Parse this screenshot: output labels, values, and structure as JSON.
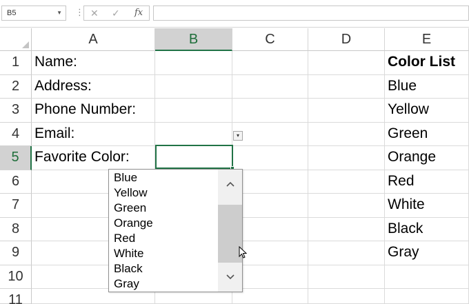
{
  "formula_bar": {
    "name_box": "B5",
    "cancel_symbol": "✕",
    "enter_symbol": "✓",
    "function_symbol": "fx",
    "formula_value": ""
  },
  "columns": [
    "A",
    "B",
    "C",
    "D",
    "E"
  ],
  "rows": [
    "1",
    "2",
    "3",
    "4",
    "5",
    "6",
    "7",
    "8",
    "9",
    "10",
    "11"
  ],
  "cells": {
    "A1": "Name:",
    "A2": "Address:",
    "A3": "Phone Number:",
    "A4": "Email:",
    "A5": "Favorite Color:",
    "E1": "Color List",
    "E2": "Blue",
    "E3": "Yellow",
    "E4": "Green",
    "E5": "Orange",
    "E6": "Red",
    "E7": "White",
    "E8": "Black",
    "E9": "Gray"
  },
  "selected_cell": "B5",
  "dropdown": {
    "options": [
      "Blue",
      "Yellow",
      "Green",
      "Orange",
      "Red",
      "White",
      "Black",
      "Gray"
    ]
  },
  "colors": {
    "selection_green": "#217346",
    "header_selected_bg": "#d2d2d2"
  },
  "icons": {
    "dropdown_arrow": "▾",
    "scroll_up": "⌃",
    "scroll_down": "⌄"
  }
}
